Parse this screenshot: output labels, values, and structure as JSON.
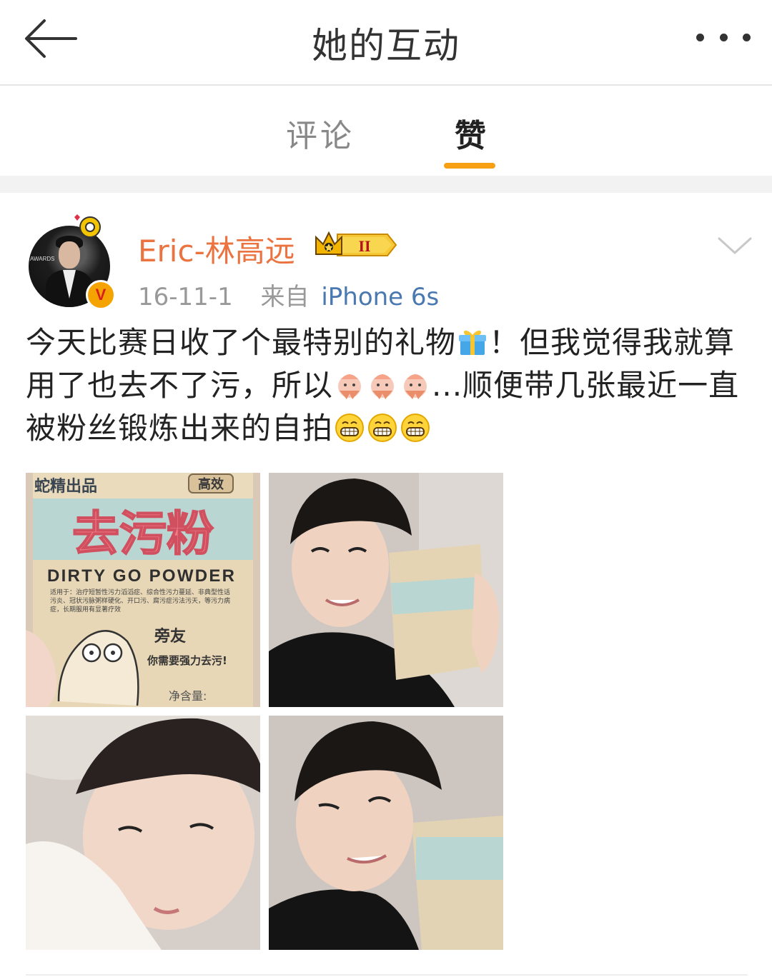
{
  "header": {
    "title": "她的互动"
  },
  "tabs": [
    {
      "label": "评论",
      "active": false
    },
    {
      "label": "赞",
      "active": true
    }
  ],
  "accent_color": "#f7a014",
  "post": {
    "author": "Eric-林高远",
    "author_color": "#eb7340",
    "verified_badge": "V",
    "date": "16-11-1",
    "source_prefix": "来自",
    "device": "iPhone 6s",
    "text_part1": "今天比赛日收了个最特别的礼物",
    "text_part2": "！但我觉得我就算用了也去不了污，所以",
    "text_part3": "...顺便带几张最近一直被粉丝锻炼出来的自拍",
    "images": [
      {
        "name": "product-photo",
        "brand": "蛇精出品",
        "badge": "高效",
        "product_cn": "去污粉",
        "product_en": "DIRTY GO POWDER",
        "desc": "适用于：治疗短暂性污力滔滔症、综合性污力蔓延、非典型性话污炎、冠状污脉粥样硬化、开口污、腐污症污法污天，等污力病症，长期服用有显著疗效",
        "mascot": "旁友",
        "slogan": "你需要强力去污!",
        "weight": "净含量:"
      },
      {
        "name": "selfie-holding-package"
      },
      {
        "name": "selfie-on-pillow"
      },
      {
        "name": "selfie-winking"
      }
    ]
  }
}
